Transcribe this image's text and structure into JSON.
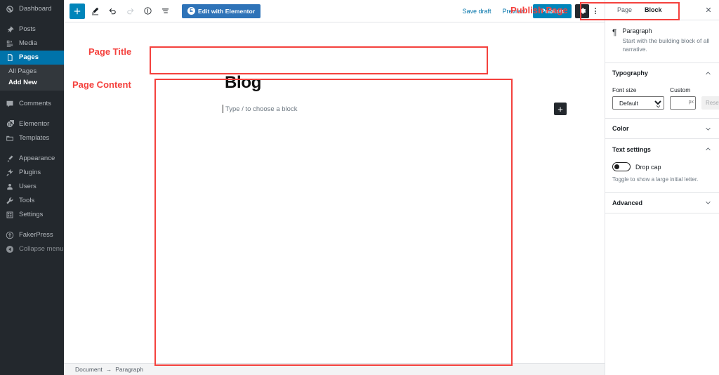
{
  "admin_sidebar": {
    "items": [
      {
        "label": "Dashboard",
        "icon": "dashboard-icon",
        "state": "normal"
      },
      {
        "label": "Posts",
        "icon": "pin-icon",
        "state": "normal"
      },
      {
        "label": "Media",
        "icon": "media-icon",
        "state": "normal"
      },
      {
        "label": "Pages",
        "icon": "pages-icon",
        "state": "current"
      },
      {
        "label": "Comments",
        "icon": "comments-icon",
        "state": "normal"
      },
      {
        "label": "Elementor",
        "icon": "elementor-icon",
        "state": "normal"
      },
      {
        "label": "Templates",
        "icon": "templates-icon",
        "state": "normal"
      },
      {
        "label": "Appearance",
        "icon": "brush-icon",
        "state": "normal"
      },
      {
        "label": "Plugins",
        "icon": "plugin-icon",
        "state": "normal"
      },
      {
        "label": "Users",
        "icon": "users-icon",
        "state": "normal"
      },
      {
        "label": "Tools",
        "icon": "wrench-icon",
        "state": "normal"
      },
      {
        "label": "Settings",
        "icon": "settings-icon",
        "state": "normal"
      },
      {
        "label": "FakerPress",
        "icon": "fakerpress-icon",
        "state": "normal"
      },
      {
        "label": "Collapse menu",
        "icon": "collapse-icon",
        "state": "dim"
      }
    ],
    "submenu": {
      "parent": "Pages",
      "items": [
        {
          "label": "All Pages",
          "current": false
        },
        {
          "label": "Add New",
          "current": true
        }
      ]
    }
  },
  "toolbar": {
    "add_block_label": "+",
    "tools_label": "Tools",
    "undo_label": "Undo",
    "redo_label": "Redo",
    "info_label": "Content structure",
    "list_view_label": "Block navigation",
    "elementor_button": "Edit with Elementor",
    "elementor_logo_letter": "E",
    "save_draft_label": "Save draft",
    "preview_label": "Preview",
    "publish_label": "Publish",
    "settings_gear_label": "Settings",
    "more_options_label": "More tools & options"
  },
  "canvas": {
    "post_title": "Blog",
    "block_placeholder": "Type / to choose a block",
    "add_block_inline": "+"
  },
  "footer": {
    "crumb_document": "Document",
    "crumb_arrow": "→",
    "crumb_block": "Paragraph"
  },
  "settings_panel": {
    "tab_page": "Page",
    "tab_block": "Block",
    "active_tab": "Block",
    "close_label": "✕",
    "block_card": {
      "icon_glyph": "¶",
      "name": "Paragraph",
      "description": "Start with the building block of all narrative."
    },
    "typography": {
      "section_title": "Typography",
      "expanded": true,
      "font_size_label": "Font size",
      "font_size_value": "Default",
      "custom_label": "Custom",
      "custom_value": "",
      "custom_unit": "px",
      "reset_label": "Reset"
    },
    "color": {
      "section_title": "Color",
      "expanded": false
    },
    "text_settings": {
      "section_title": "Text settings",
      "expanded": true,
      "drop_cap_label": "Drop cap",
      "drop_cap_on": false,
      "drop_cap_help": "Toggle to show a large initial letter."
    },
    "advanced": {
      "section_title": "Advanced",
      "expanded": false
    }
  },
  "annotations": {
    "color": "#f4413d",
    "page_title": "Page Title",
    "page_content": "Page Content",
    "publish_page": "Publish Page"
  }
}
